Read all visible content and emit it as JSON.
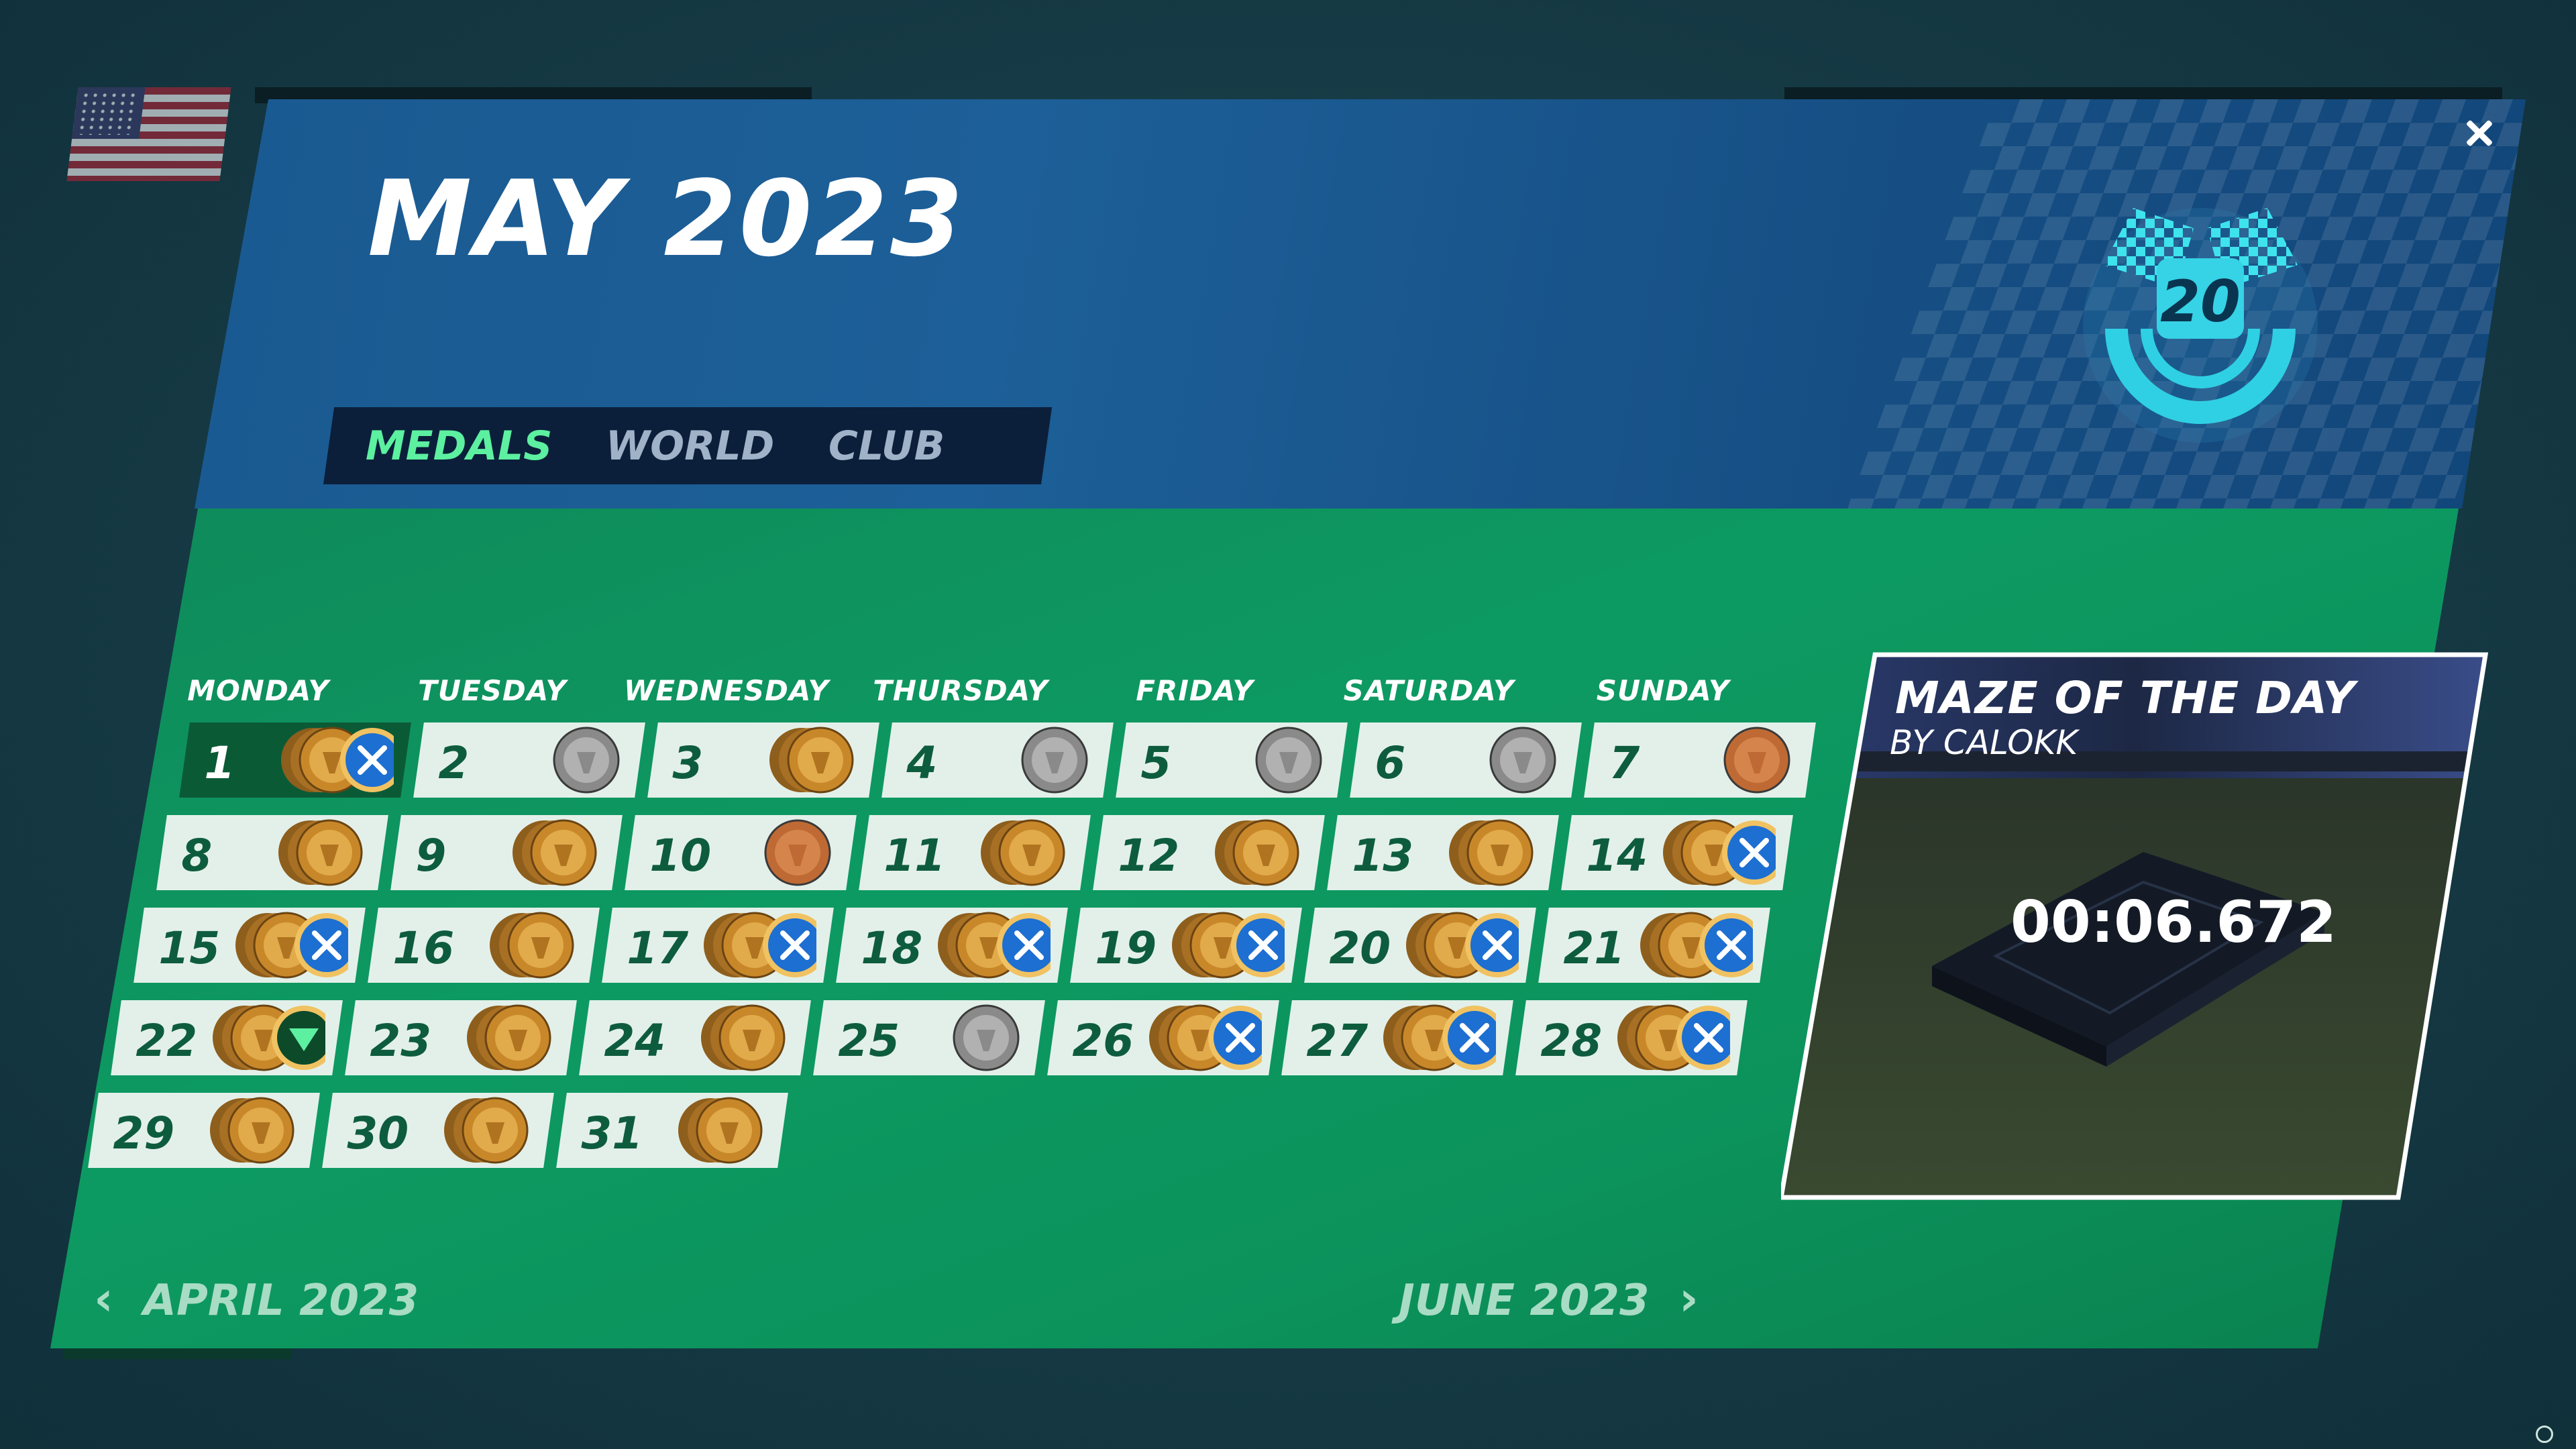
{
  "title": "MAY 2023",
  "close_icon": "close-icon",
  "streak": {
    "icon": "checkered-flags-streak-icon",
    "count": "20"
  },
  "tabs": [
    {
      "label": "MEDALS",
      "active": true
    },
    {
      "label": "WORLD",
      "active": false
    },
    {
      "label": "CLUB",
      "active": false
    }
  ],
  "weekdays": [
    "MONDAY",
    "TUESDAY",
    "WEDNESDAY",
    "THURSDAY",
    "FRIDAY",
    "SATURDAY",
    "SUNDAY"
  ],
  "today": "1",
  "days": [
    {
      "day": "1",
      "medal": "gold",
      "icon": "crossed-swords"
    },
    {
      "day": "2",
      "medal": "silver",
      "icon": ""
    },
    {
      "day": "3",
      "medal": "gold",
      "icon": ""
    },
    {
      "day": "4",
      "medal": "silver",
      "icon": ""
    },
    {
      "day": "5",
      "medal": "silver",
      "icon": ""
    },
    {
      "day": "6",
      "medal": "silver",
      "icon": ""
    },
    {
      "day": "7",
      "medal": "bronze",
      "icon": ""
    },
    {
      "day": "8",
      "medal": "gold",
      "icon": ""
    },
    {
      "day": "9",
      "medal": "gold",
      "icon": ""
    },
    {
      "day": "10",
      "medal": "bronze",
      "icon": ""
    },
    {
      "day": "11",
      "medal": "gold",
      "icon": ""
    },
    {
      "day": "12",
      "medal": "gold",
      "icon": ""
    },
    {
      "day": "13",
      "medal": "gold",
      "icon": ""
    },
    {
      "day": "14",
      "medal": "gold",
      "icon": "crossed-swords"
    },
    {
      "day": "15",
      "medal": "gold",
      "icon": "crossed-swords"
    },
    {
      "day": "16",
      "medal": "gold",
      "icon": ""
    },
    {
      "day": "17",
      "medal": "gold",
      "icon": "crossed-swords"
    },
    {
      "day": "18",
      "medal": "gold",
      "icon": "crossed-swords"
    },
    {
      "day": "19",
      "medal": "gold",
      "icon": "crossed-swords"
    },
    {
      "day": "20",
      "medal": "gold",
      "icon": "crossed-swords"
    },
    {
      "day": "21",
      "medal": "gold",
      "icon": "crossed-swords"
    },
    {
      "day": "22",
      "medal": "gold",
      "icon": "green-special"
    },
    {
      "day": "23",
      "medal": "gold",
      "icon": ""
    },
    {
      "day": "24",
      "medal": "gold",
      "icon": ""
    },
    {
      "day": "25",
      "medal": "silver",
      "icon": ""
    },
    {
      "day": "26",
      "medal": "gold",
      "icon": "crossed-swords"
    },
    {
      "day": "27",
      "medal": "gold",
      "icon": "crossed-swords"
    },
    {
      "day": "28",
      "medal": "gold",
      "icon": "crossed-swords"
    },
    {
      "day": "29",
      "medal": "gold",
      "icon": ""
    },
    {
      "day": "30",
      "medal": "gold",
      "icon": ""
    },
    {
      "day": "31",
      "medal": "gold",
      "icon": ""
    }
  ],
  "maze": {
    "title": "MAZE OF THE DAY",
    "author": "BY CALOKK",
    "time": "00:06.672"
  },
  "nav": {
    "prev_label": "APRIL 2023",
    "next_label": "JUNE 2023",
    "prev_icon": "chevron-left-icon",
    "next_icon": "chevron-right-icon"
  },
  "colors": {
    "gold": "#c8882a",
    "silver": "#8c8c8c",
    "bronze": "#c06a35",
    "badge_blue": "#1d6fd1",
    "accent_green": "#5cf0a0"
  }
}
